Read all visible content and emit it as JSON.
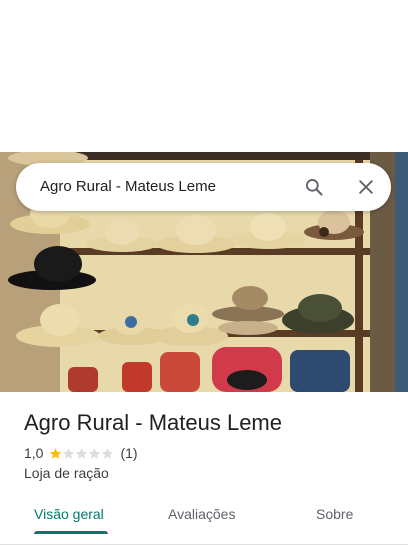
{
  "search": {
    "query": "Agro Rural - Mateus Leme"
  },
  "place": {
    "name": "Agro Rural - Mateus Leme",
    "rating": "1,0",
    "stars_filled": 1,
    "stars_total": 5,
    "review_count": "(1)",
    "category": "Loja de ração"
  },
  "tabs": [
    {
      "label": "Visão geral",
      "active": true
    },
    {
      "label": "Avaliações",
      "active": false
    },
    {
      "label": "Sobre",
      "active": false
    }
  ],
  "colors": {
    "accent": "#00796b",
    "star_filled": "#fbbc04",
    "star_empty": "#dadce0"
  }
}
